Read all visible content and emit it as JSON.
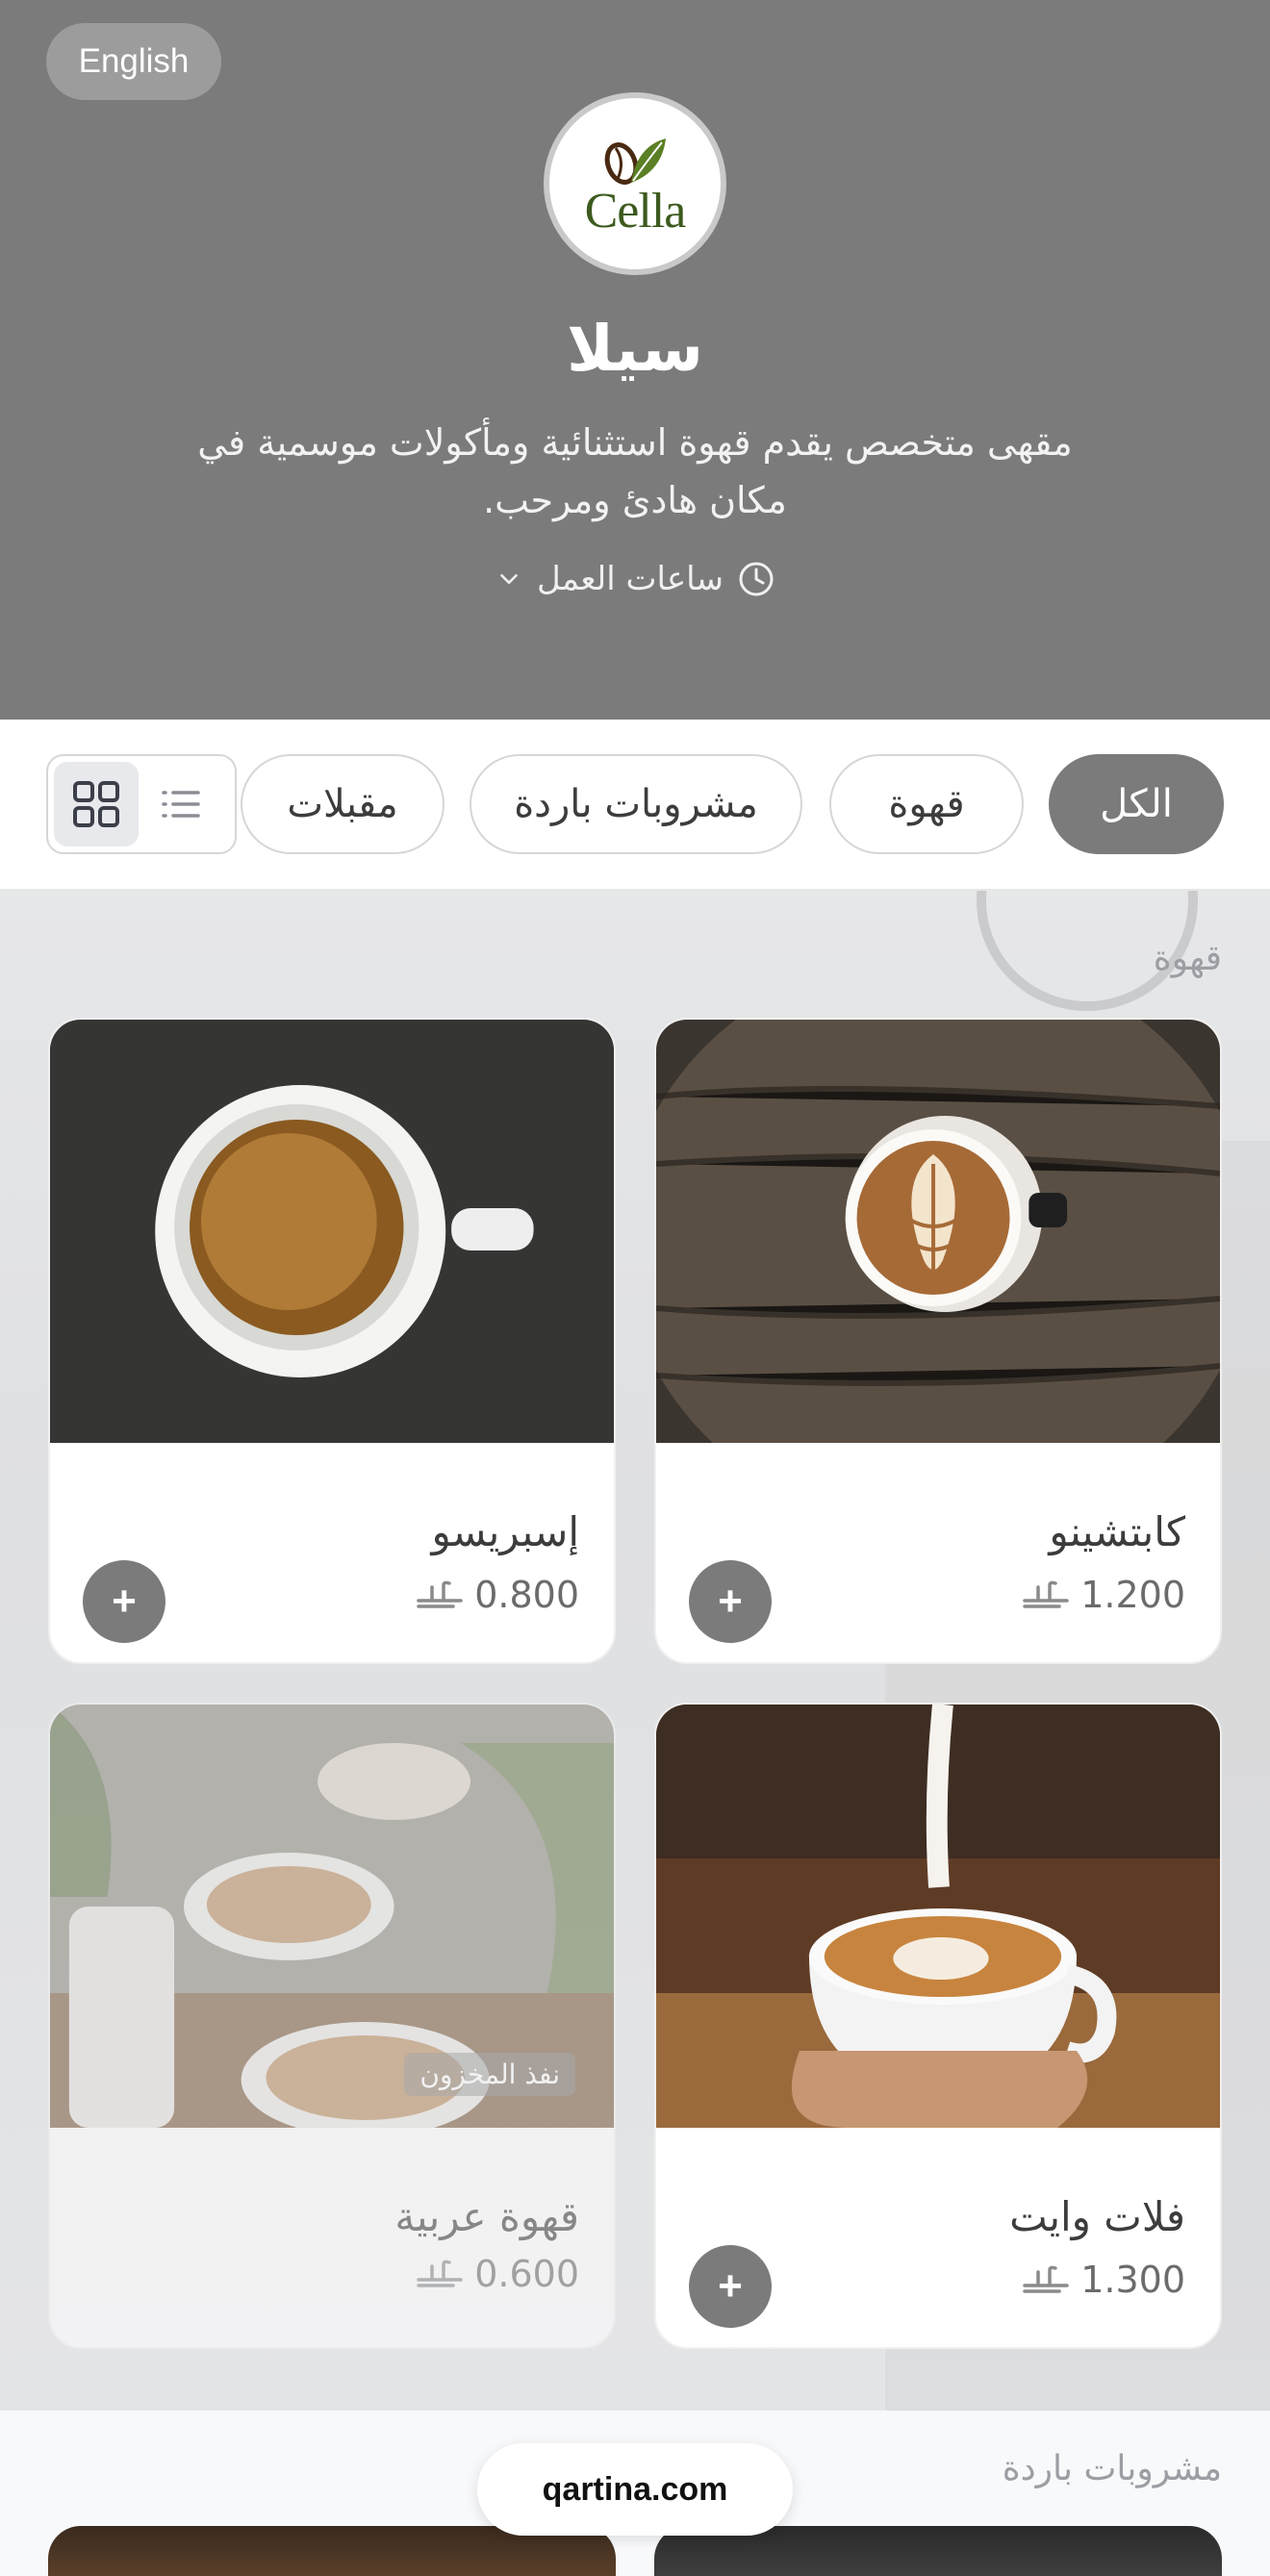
{
  "header": {
    "language_button": "English",
    "logo_text": "Cella",
    "cafe_name": "سيلا",
    "description": "مقهى متخصص يقدم قهوة استثنائية ومأكولات موسمية في مكان هادئ ومرحب.",
    "hours_label": "ساعات العمل",
    "colors": {
      "header_bg": "#7b7b7b",
      "accent": "#7b7b7b"
    }
  },
  "categories": {
    "chips": [
      {
        "label": "الكل",
        "active": true
      },
      {
        "label": "قهوة",
        "active": false
      },
      {
        "label": "مشروبات باردة",
        "active": false
      },
      {
        "label": "مقبلات",
        "active": false
      }
    ],
    "view_modes": [
      "list-icon",
      "grid-icon"
    ],
    "selected_view": "grid"
  },
  "sections": [
    {
      "title": "قهوة",
      "items": [
        {
          "name": "كابتشينو",
          "price": "1.200",
          "currency_icon": "currency-icon",
          "available": true
        },
        {
          "name": "إسبريسو",
          "price": "0.800",
          "currency_icon": "currency-icon",
          "available": true
        },
        {
          "name": "فلات وايت",
          "price": "1.300",
          "currency_icon": "currency-icon",
          "available": true
        },
        {
          "name": "قهوة عربية",
          "price": "0.600",
          "currency_icon": "currency-icon",
          "available": false,
          "badge": "نفذ المخزون"
        }
      ]
    },
    {
      "title": "مشروبات باردة"
    }
  ],
  "footer": {
    "site": "qartina.com"
  }
}
